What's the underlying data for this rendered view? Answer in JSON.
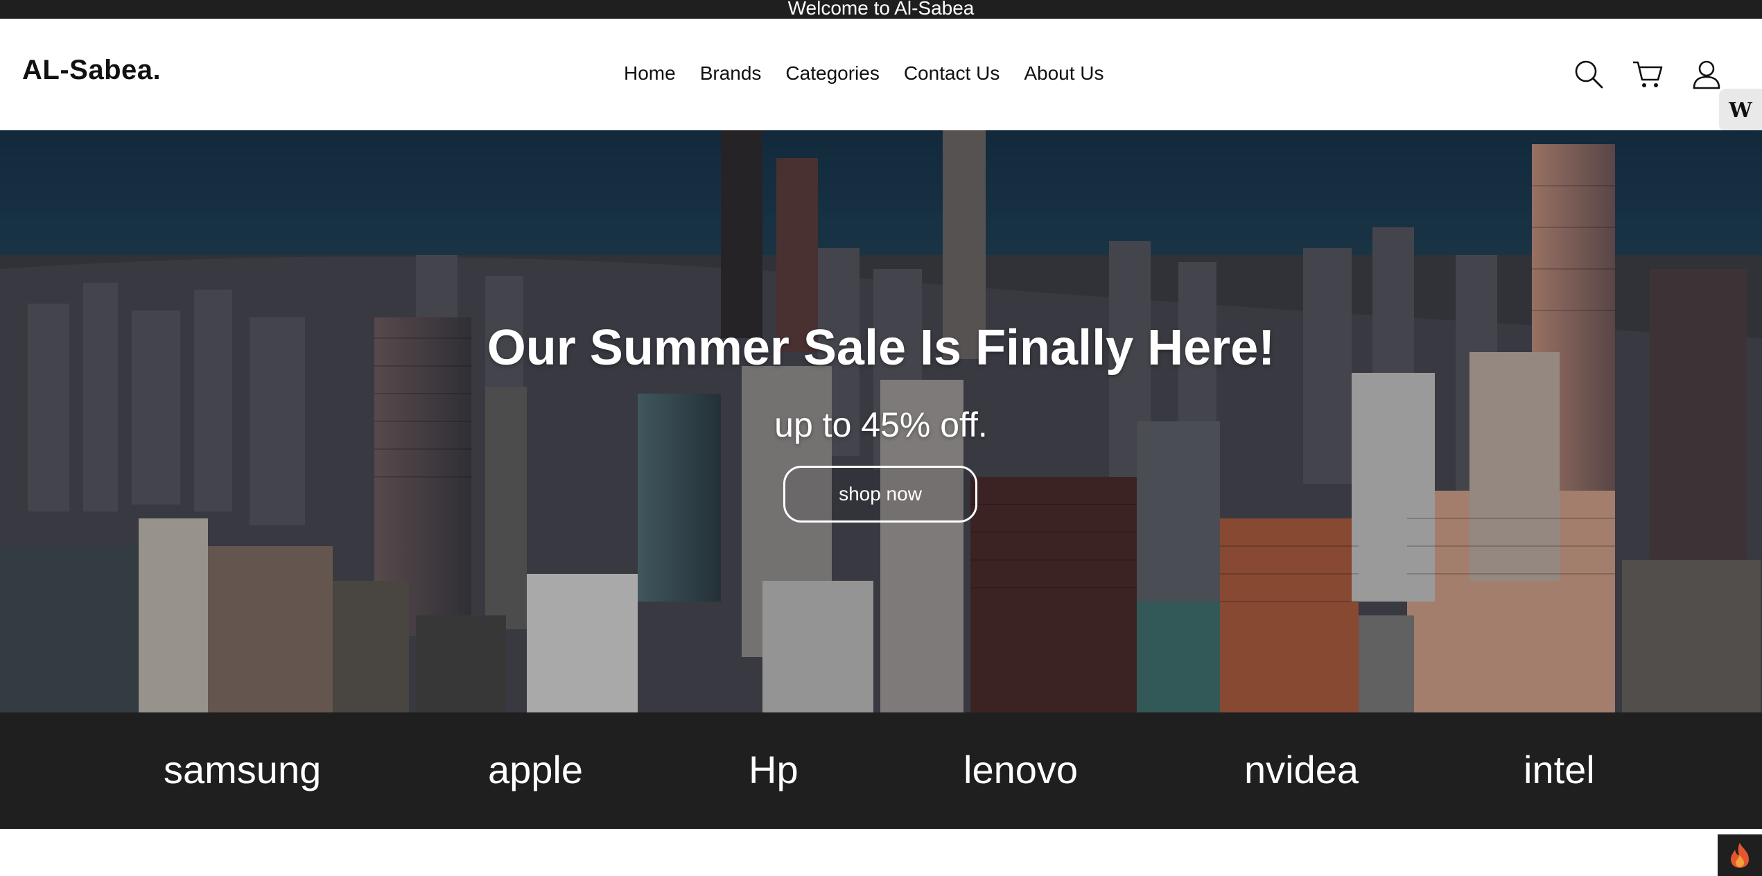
{
  "announcement": "Welcome to Al-Sabea",
  "header": {
    "logo": "AL-Sabea.",
    "nav": [
      "Home",
      "Brands",
      "Categories",
      "Contact Us",
      "About Us"
    ],
    "icons": [
      "search-icon",
      "cart-icon",
      "user-icon"
    ]
  },
  "side_badge": {
    "label": "W"
  },
  "hero": {
    "title": "Our Summer Sale Is Finally Here!",
    "subtitle": "up to 45% off.",
    "button": "shop now"
  },
  "brands": [
    "samsung",
    "apple",
    "Hp",
    "lenovo",
    "nvidea",
    "intel"
  ],
  "colors": {
    "dark_bar": "#1f1f1f",
    "text_dark": "#111111",
    "white": "#ffffff"
  }
}
